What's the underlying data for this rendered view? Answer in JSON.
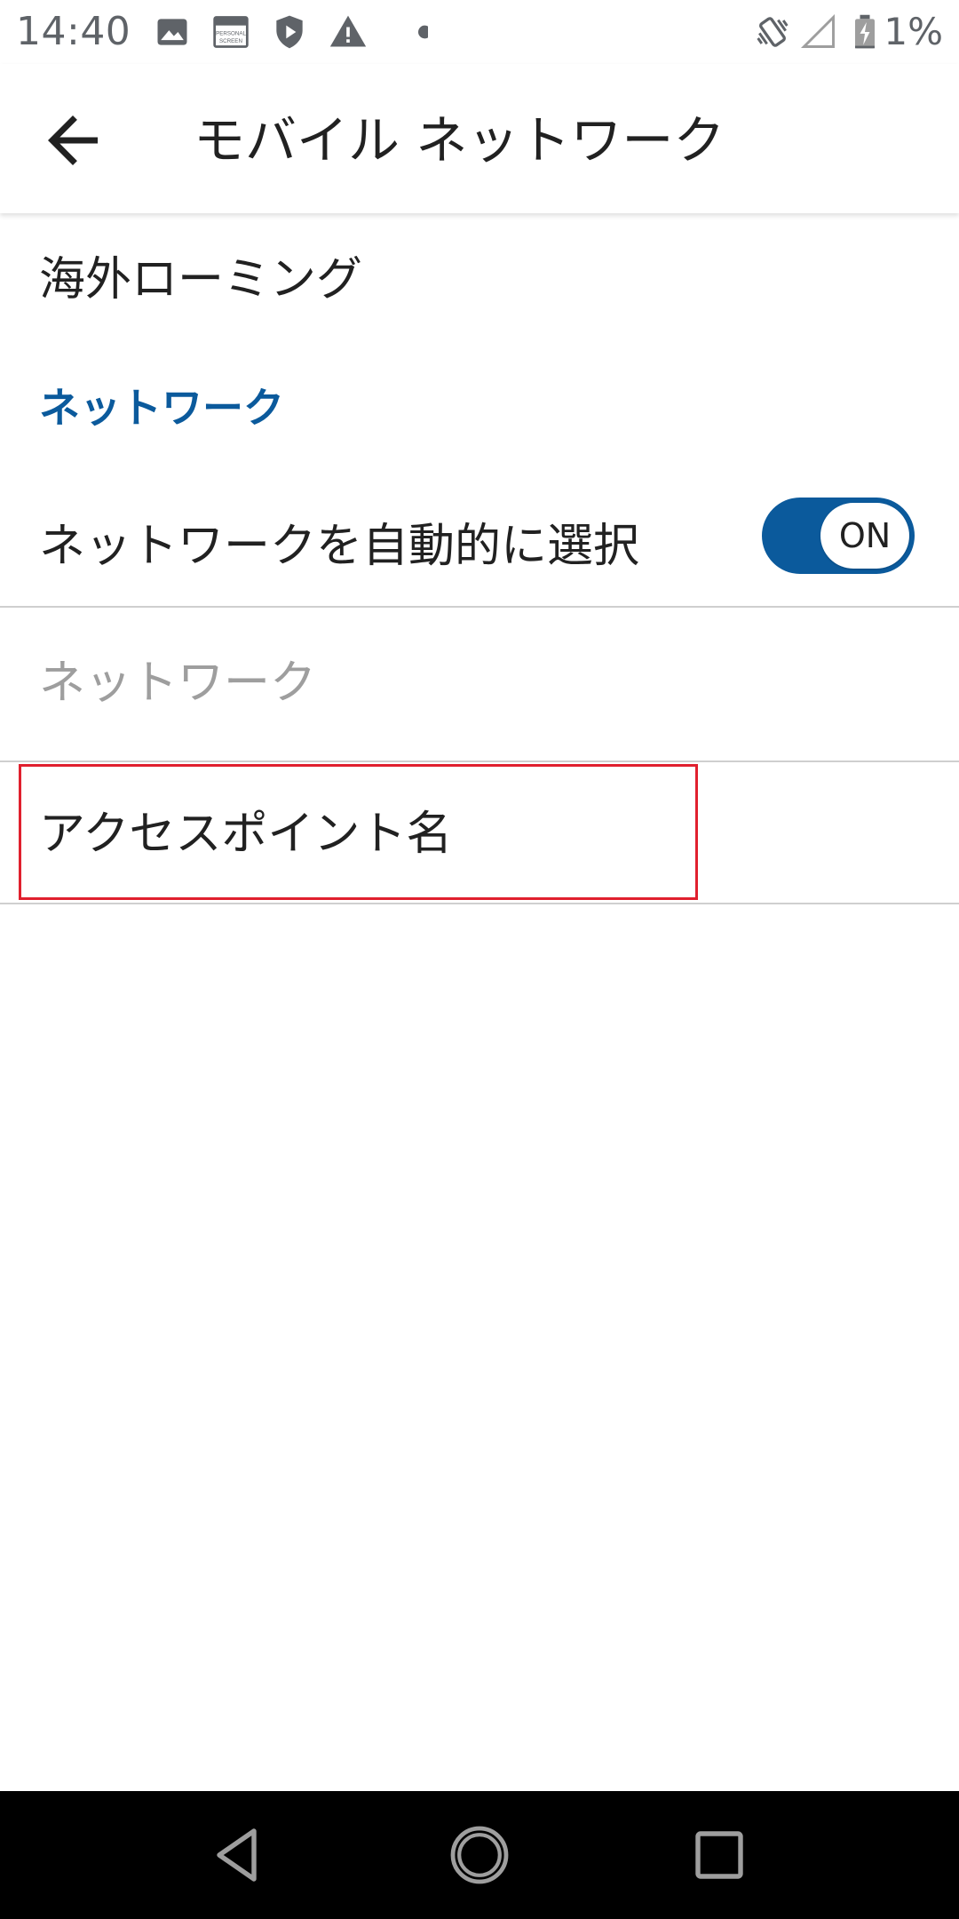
{
  "status_bar": {
    "time": "14:40",
    "icons_left": [
      "image-icon",
      "personal-screen-icon",
      "shield-play-icon",
      "warning-icon",
      "dot-icon"
    ],
    "personal_screen_label": "PERSONAL SCREEN",
    "icons_right": [
      "vibrate-icon",
      "signal-icon",
      "battery-charging-icon"
    ],
    "battery_text": "1%"
  },
  "app_bar": {
    "title": "モバイル ネットワーク",
    "back_icon": "arrow-back-icon"
  },
  "prefs": {
    "roaming_label": "海外ローミング",
    "network_section_header": "ネットワーク",
    "auto_select_label": "ネットワークを自動的に選択",
    "auto_select_toggle": "ON",
    "network_label": "ネットワーク",
    "apn_label": "アクセスポイント名"
  },
  "colors": {
    "accent": "#0b5a9c",
    "highlight": "#e0202e",
    "disabled_text": "#9e9e9e"
  },
  "nav_bar": {
    "buttons": [
      "nav-back-icon",
      "nav-home-icon",
      "nav-recents-icon"
    ]
  }
}
